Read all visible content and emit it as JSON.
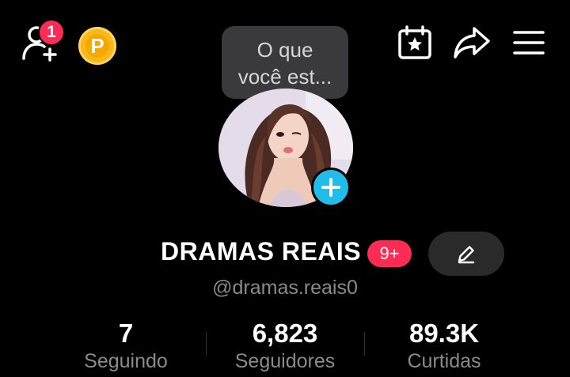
{
  "header": {
    "notification_count": "1",
    "coin_label": "P",
    "accent_color": "#fe2c55",
    "coin_color": "#f8b81c",
    "icons": [
      "add-friend-icon",
      "coin-icon",
      "calendar-star-icon",
      "share-icon",
      "menu-icon"
    ]
  },
  "status_bubble": {
    "line1": "O que",
    "line2": "você est..."
  },
  "profile": {
    "display_name": "DRAMAS REAIS",
    "level_badge": "9+",
    "username": "@dramas.reais0",
    "add_avatar_color": "#20bcea"
  },
  "stats": [
    {
      "value": "7",
      "label": "Seguindo"
    },
    {
      "value": "6,823",
      "label": "Seguidores"
    },
    {
      "value": "89.3K",
      "label": "Curtidas"
    }
  ]
}
